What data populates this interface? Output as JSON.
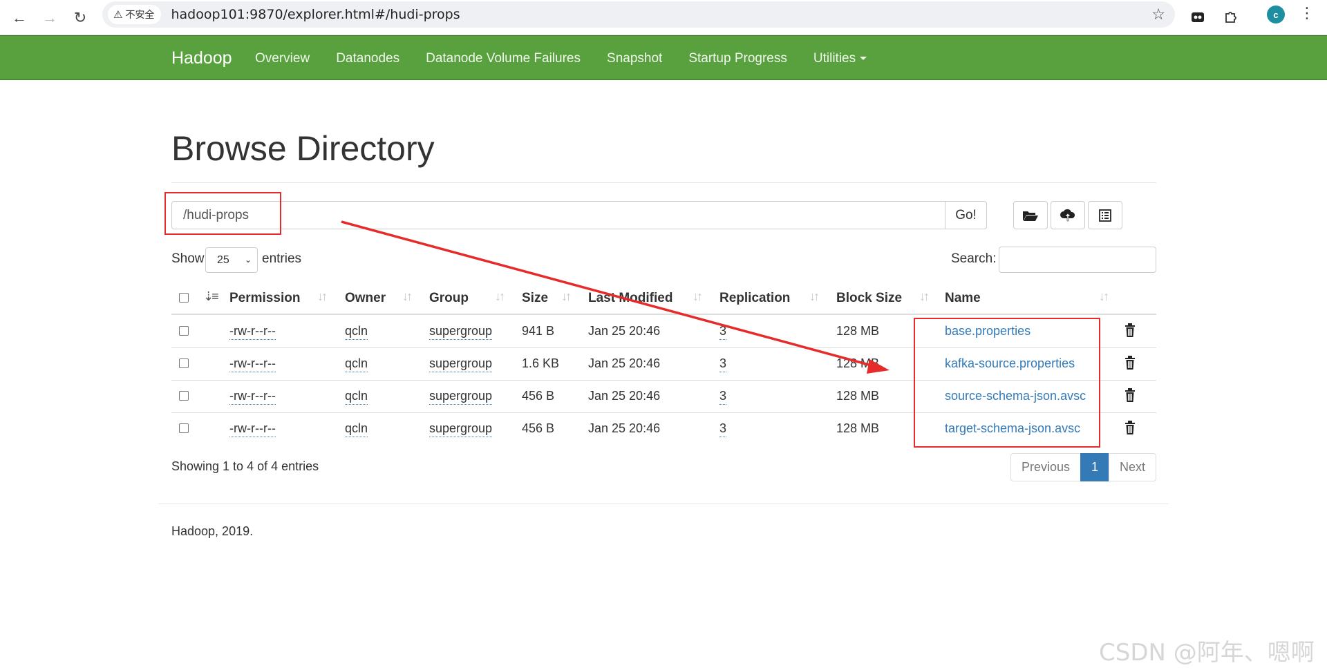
{
  "browser": {
    "security_label": "不安全",
    "url": "hadoop101:9870/explorer.html#/hudi-props",
    "avatar_letter": "c"
  },
  "navbar": {
    "brand": "Hadoop",
    "links": [
      "Overview",
      "Datanodes",
      "Datanode Volume Failures",
      "Snapshot",
      "Startup Progress",
      "Utilities"
    ]
  },
  "page": {
    "title": "Browse Directory",
    "path_value": "/hudi-props",
    "go_label": "Go!"
  },
  "controls": {
    "show_label": "Show",
    "page_length": "25",
    "entries_label": "entries",
    "search_label": "Search:"
  },
  "table": {
    "headers": [
      "Permission",
      "Owner",
      "Group",
      "Size",
      "Last Modified",
      "Replication",
      "Block Size",
      "Name"
    ],
    "rows": [
      {
        "permission": "-rw-r--r--",
        "owner": "qcln",
        "group": "supergroup",
        "size": "941 B",
        "modified": "Jan 25 20:46",
        "replication": "3",
        "block_size": "128 MB",
        "name": "base.properties"
      },
      {
        "permission": "-rw-r--r--",
        "owner": "qcln",
        "group": "supergroup",
        "size": "1.6 KB",
        "modified": "Jan 25 20:46",
        "replication": "3",
        "block_size": "128 MB",
        "name": "kafka-source.properties"
      },
      {
        "permission": "-rw-r--r--",
        "owner": "qcln",
        "group": "supergroup",
        "size": "456 B",
        "modified": "Jan 25 20:46",
        "replication": "3",
        "block_size": "128 MB",
        "name": "source-schema-json.avsc"
      },
      {
        "permission": "-rw-r--r--",
        "owner": "qcln",
        "group": "supergroup",
        "size": "456 B",
        "modified": "Jan 25 20:46",
        "replication": "3",
        "block_size": "128 MB",
        "name": "target-schema-json.avsc"
      }
    ]
  },
  "pagination": {
    "info": "Showing 1 to 4 of 4 entries",
    "previous": "Previous",
    "current": "1",
    "next": "Next"
  },
  "footer": {
    "text": "Hadoop, 2019."
  },
  "watermark": "CSDN @阿年、嗯啊",
  "colors": {
    "navbar": "#59a13f",
    "link": "#337ab7",
    "annotation": "#e62b2b"
  }
}
